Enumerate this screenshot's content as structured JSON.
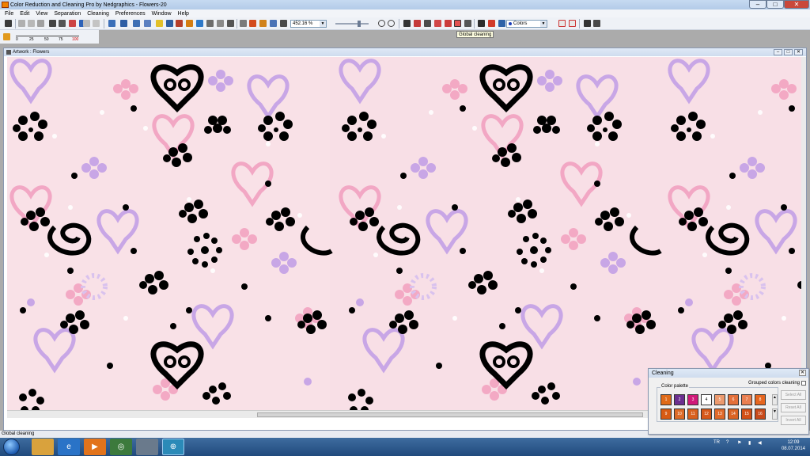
{
  "app": {
    "title": "Color Reduction and Cleaning Pro by Nedgraphics - Flowers-20",
    "window_controls": {
      "minimize": "–",
      "maximize": "□",
      "close": "✕"
    }
  },
  "menu": [
    "File",
    "Edit",
    "View",
    "Separation",
    "Cleaning",
    "Preferences",
    "Window",
    "Help"
  ],
  "toolbar": {
    "zoom_value": "452.16 %",
    "colors_select": "Colors",
    "tooltip": "Global cleaning"
  },
  "tolerance_ruler": {
    "labels": [
      "0",
      "25",
      "50",
      "75",
      "100"
    ]
  },
  "document": {
    "title": "Artwork : Flowers"
  },
  "statusbar": {
    "text": "Global cleaning"
  },
  "cleaning_panel": {
    "title": "Cleaning",
    "grouped_label": "Grouped colors cleaning",
    "palette_label": "Color palette",
    "row1": [
      {
        "label": "1",
        "color": "#e06a18"
      },
      {
        "label": "2",
        "color": "#6b2f8f"
      },
      {
        "label": "3",
        "color": "#d01a79"
      },
      {
        "label": "4",
        "color": "#ffffff"
      },
      {
        "label": "5",
        "color": "#ec9a6e"
      },
      {
        "label": "6",
        "color": "#e4703a"
      },
      {
        "label": "7",
        "color": "#ea7f50"
      },
      {
        "label": "8",
        "color": "#e6661f"
      }
    ],
    "row2": [
      {
        "label": "9",
        "color": "#d85b14"
      },
      {
        "label": "10",
        "color": "#dc6a28"
      },
      {
        "label": "11",
        "color": "#d9601e"
      },
      {
        "label": "12",
        "color": "#d6581a"
      },
      {
        "label": "13",
        "color": "#e0692a"
      },
      {
        "label": "14",
        "color": "#db6324"
      },
      {
        "label": "15",
        "color": "#d35016"
      },
      {
        "label": "16",
        "color": "#c84a1a"
      }
    ],
    "buttons": [
      "Select All",
      "Reset All",
      "Invert All"
    ]
  },
  "taskbar": {
    "apps": [
      "explorer",
      "ie",
      "media",
      "chrome",
      "app5",
      "app6"
    ],
    "language": "TR",
    "time": "12:09",
    "date": "08.07.2014"
  },
  "colors": {
    "pattern_bg": "#f8dfe6",
    "pink": "#f3a9c4",
    "lavender": "#c3a8e4",
    "black": "#000000"
  }
}
